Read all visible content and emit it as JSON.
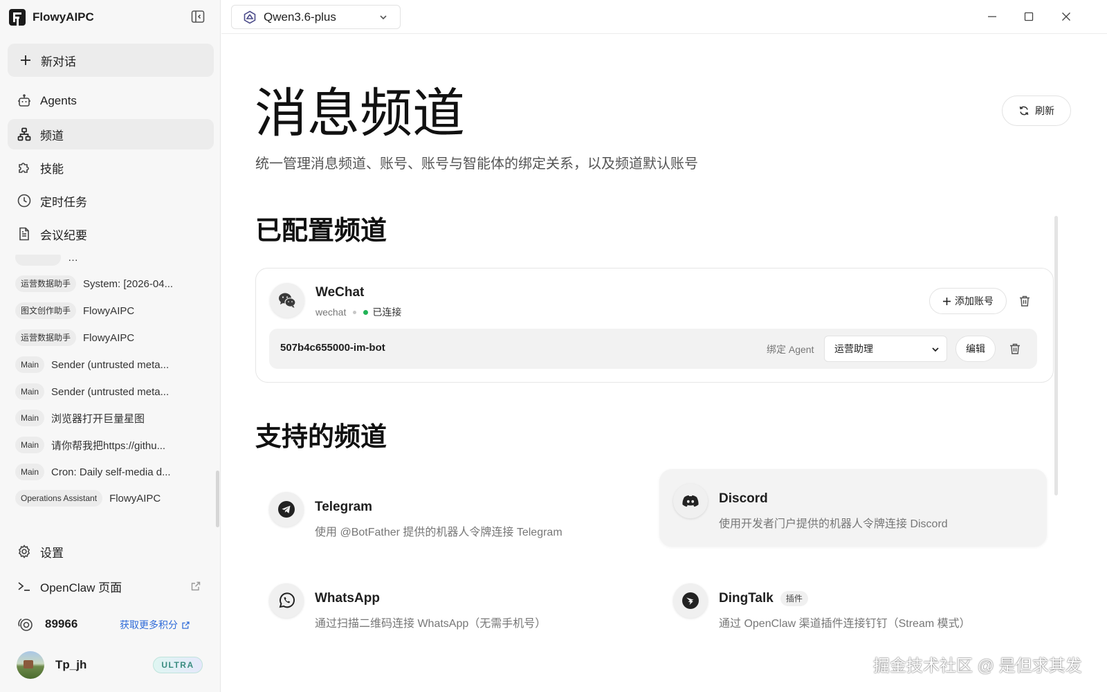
{
  "app": {
    "name": "FlowyAIPC"
  },
  "sidebar": {
    "new_chat_label": "新对话",
    "nav": [
      {
        "label": "Agents",
        "icon": "robot-icon"
      },
      {
        "label": "频道",
        "icon": "network-icon",
        "active": true
      },
      {
        "label": "技能",
        "icon": "puzzle-icon"
      },
      {
        "label": "定时任务",
        "icon": "clock-icon"
      },
      {
        "label": "会议纪要",
        "icon": "document-icon"
      }
    ],
    "history": [
      {
        "tag": "",
        "title": "…"
      },
      {
        "tag": "运营数据助手",
        "title": "System: [2026-04..."
      },
      {
        "tag": "图文创作助手",
        "title": "FlowyAIPC"
      },
      {
        "tag": "运营数据助手",
        "title": "FlowyAIPC"
      },
      {
        "tag": "Main",
        "title": "Sender (untrusted meta..."
      },
      {
        "tag": "Main",
        "title": "Sender (untrusted meta..."
      },
      {
        "tag": "Main",
        "title": "浏览器打开巨量星图"
      },
      {
        "tag": "Main",
        "title": "请你帮我把https://githu..."
      },
      {
        "tag": "Main",
        "title": "Cron: Daily self-media d..."
      },
      {
        "tag": "Operations Assistant",
        "title": "FlowyAIPC"
      }
    ],
    "settings_label": "设置",
    "openclaw_label": "OpenClaw 页面",
    "credits": {
      "value": "89966",
      "more_label": "获取更多积分"
    },
    "user": {
      "name": "Tp_jh",
      "plan": "ULTRA"
    }
  },
  "topbar": {
    "model": "Qwen3.6-plus"
  },
  "main": {
    "title": "消息频道",
    "description": "统一管理消息频道、账号、账号与智能体的绑定关系，以及频道默认账号",
    "refresh_label": "刷新",
    "configured_title": "已配置频道",
    "configured": [
      {
        "name": "WeChat",
        "id": "wechat",
        "status": "已连接",
        "add_account_label": "添加账号",
        "accounts": [
          {
            "id": "507b4c655000-im-bot",
            "bind_label": "绑定 Agent",
            "agent": "运营助理",
            "edit_label": "编辑"
          }
        ]
      }
    ],
    "supported_title": "支持的频道",
    "supported": [
      {
        "name": "Telegram",
        "desc": "使用 @BotFather 提供的机器人令牌连接 Telegram",
        "icon": "telegram-icon",
        "tag": ""
      },
      {
        "name": "Discord",
        "desc": "使用开发者门户提供的机器人令牌连接 Discord",
        "icon": "discord-icon",
        "tag": ""
      },
      {
        "name": "WhatsApp",
        "desc": "通过扫描二维码连接 WhatsApp（无需手机号）",
        "icon": "whatsapp-icon",
        "tag": ""
      },
      {
        "name": "DingTalk",
        "desc": "通过 OpenClaw 渠道插件连接钉钉（Stream 模式）",
        "icon": "dingtalk-icon",
        "tag": "插件"
      }
    ]
  },
  "watermark": "掘金技术社区 @ 是但求其发",
  "colors": {
    "accent_link": "#2f6bd8",
    "status_green": "#22b357",
    "sidebar_bg": "#f7f7f7"
  }
}
